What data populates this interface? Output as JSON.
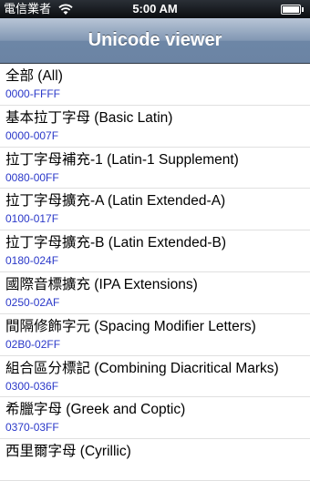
{
  "status_bar": {
    "carrier": "電信業者",
    "time": "5:00 AM"
  },
  "nav_bar": {
    "title": "Unicode viewer"
  },
  "list": {
    "items": [
      {
        "title": "全部 (All)",
        "range": "0000-FFFF"
      },
      {
        "title": "基本拉丁字母 (Basic Latin)",
        "range": "0000-007F"
      },
      {
        "title": "拉丁字母補充-1 (Latin-1 Supplement)",
        "range": "0080-00FF"
      },
      {
        "title": "拉丁字母擴充-A (Latin Extended-A)",
        "range": "0100-017F"
      },
      {
        "title": "拉丁字母擴充-B (Latin Extended-B)",
        "range": "0180-024F"
      },
      {
        "title": "國際音標擴充 (IPA Extensions)",
        "range": "0250-02AF"
      },
      {
        "title": "間隔修飾字元 (Spacing Modifier Letters)",
        "range": "02B0-02FF"
      },
      {
        "title": "組合區分標記 (Combining Diacritical Marks)",
        "range": "0300-036F"
      },
      {
        "title": "希臘字母 (Greek and Coptic)",
        "range": "0370-03FF"
      },
      {
        "title": "西里爾字母 (Cyrillic)",
        "range": ""
      }
    ]
  },
  "icons": {
    "wifi": "wifi-icon",
    "battery": "battery-icon"
  },
  "colors": {
    "range_text": "#2a38c9",
    "nav_bar": "#6d86a6"
  }
}
